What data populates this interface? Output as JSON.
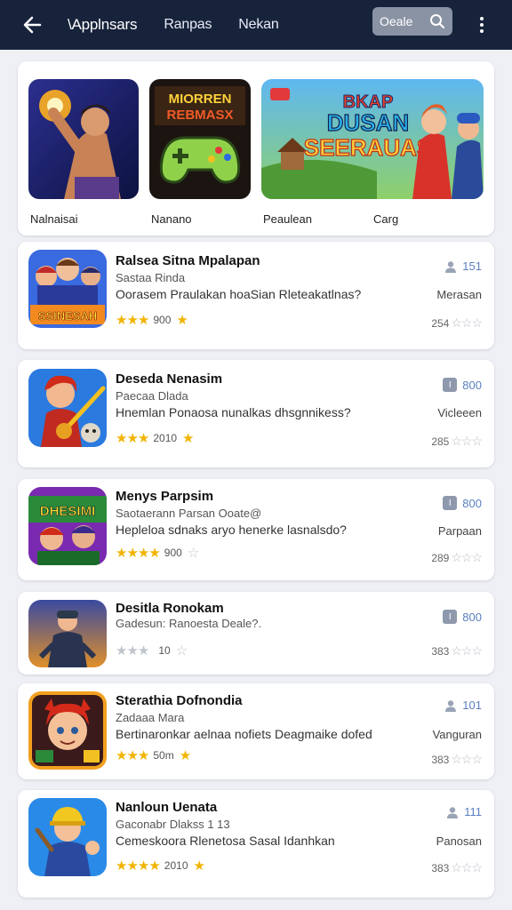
{
  "appbar": {
    "tabs": [
      "\\Applnsars",
      "Ranpas",
      "Nekan"
    ],
    "search_label": "Oeale",
    "colors": {
      "bar": "#17223b",
      "search": "#8a93a4"
    }
  },
  "featured": {
    "tiles": [
      {
        "label": "Nalnaisai",
        "icon": "hero-game-art"
      },
      {
        "label": "Nanano",
        "icon": "controller-game-art",
        "art_text": [
          "MIORREN",
          "REBMASX"
        ]
      },
      {
        "label": "Peaulean",
        "icon": "adventure-game-art",
        "art_text": [
          "BKAP",
          "DUSAN",
          "SEERAUAS"
        ]
      },
      {
        "label": "Carg"
      }
    ]
  },
  "games": [
    {
      "title": "Ralsea Sitna Mpalapan",
      "subtitle": "Sastaa Rinda",
      "description": "Oorasem Praulakan hoaSian Rleteakatlnas?",
      "stars_text": "★★★",
      "rating": "900",
      "extra_star": "★",
      "badge": "151",
      "side": "Merasan",
      "count": "254",
      "icon": "squad-game-icon",
      "icon_text": "SSINESAH"
    },
    {
      "title": "Deseda Nenasim",
      "subtitle": "Paecaa Dlada",
      "description": "Hnemlan Ponaosa nunalkas dhsgnnikess?",
      "stars_text": "★★★",
      "rating": "2010",
      "extra_star": "★",
      "badge": "800",
      "side": "Vicleeen",
      "count": "285",
      "icon": "guitar-game-icon"
    },
    {
      "title": "Menys Parpsim",
      "subtitle": "Saotaerann Parsan Ooate@",
      "description": "Hepleloa sdnaks aryo henerke lasnalsdo?",
      "stars_text": "★★★★",
      "rating": "900",
      "extra_star": "☆",
      "badge": "800",
      "side": "Parpaan",
      "count": "289",
      "icon": "brawl-game-icon",
      "icon_text": "DHESIMI"
    },
    {
      "title": "Desitla Ronokam",
      "subtitle": "Gadesun: Ranoesta Deale?.",
      "description": "",
      "stars_text": "★★★",
      "rating": "10",
      "extra_star": "☆",
      "badge": "800",
      "side": "",
      "count": "383",
      "icon": "soldier-game-icon",
      "muted": true
    },
    {
      "title": "Sterathia Dofnondia",
      "subtitle": "Zadaaa Mara",
      "description": "Bertinaronkar aelnaa nofiets Deagmaike dofed",
      "stars_text": "★★★",
      "rating": "50m",
      "extra_star": "★",
      "badge": "101",
      "side": "Vanguran",
      "count": "383",
      "icon": "fox-kid-game-icon"
    },
    {
      "title": "Nanloun Uenata",
      "subtitle": "Gaconabr Dlakss 1 13",
      "description": "Cemeskoora Rlenetosa Sasal Idanhkan",
      "stars_text": "★★★★",
      "rating": "2010",
      "extra_star": "★",
      "badge": "111",
      "side": "Panosan",
      "count": "383",
      "icon": "miner-game-icon"
    }
  ],
  "colors": {
    "star": "#f2b400",
    "badge": "#5b7fbf",
    "background": "#eef0f5"
  }
}
